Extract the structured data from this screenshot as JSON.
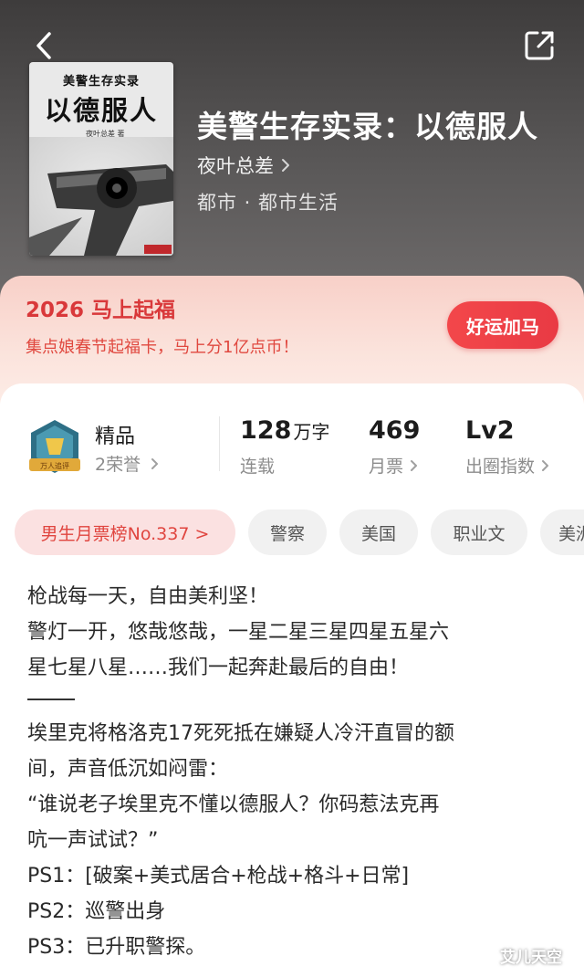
{
  "header": {
    "back_icon": "back-arrow-icon",
    "share_icon": "share-icon"
  },
  "book": {
    "cover": {
      "series_text": "美警生存实录",
      "title_text": "以德服人",
      "author_text": "夜叶总差 著"
    },
    "title": "美警生存实录：以德服人",
    "author": "夜叶总差",
    "category": "都市 · 都市生活"
  },
  "promo": {
    "title": "2026 马上起福",
    "subtitle": "集点娘春节起福卡，马上分1亿点币！",
    "button_label": "好运加马",
    "colors": {
      "accent": "#e93a44",
      "background": "#fbe3dc"
    }
  },
  "stats": {
    "honor": {
      "title": "精品",
      "subtitle": "2荣誉",
      "badge_text": "万人追评"
    },
    "words": {
      "value": "128",
      "unit": "万字",
      "label": "连载"
    },
    "monthly_tickets": {
      "value": "469",
      "label": "月票"
    },
    "influence": {
      "value": "Lv2",
      "label": "出圈指数"
    }
  },
  "tags": {
    "rank": "男生月票榜No.337 >",
    "items": [
      "警察",
      "美国",
      "职业文",
      "美洲"
    ]
  },
  "synopsis": {
    "lines_a": [
      "枪战每一天，自由美利坚！",
      "警灯一开，悠哉悠哉，一星二星三星四星五星六",
      "星七星八星……我们一起奔赴最后的自由！"
    ],
    "lines_b": [
      "埃里克将格洛克17死死抵在嫌疑人冷汗直冒的额",
      "间，声音低沉如闷雷：",
      "“谁说老子埃里克不懂以德服人？你码惹法克再",
      "吭一声试试？”",
      "PS1：[破案+美式居合+枪战+格斗+日常]",
      "PS2：巡警出身",
      "PS3：已升职警探。"
    ]
  },
  "watermark": "艾儿天空"
}
